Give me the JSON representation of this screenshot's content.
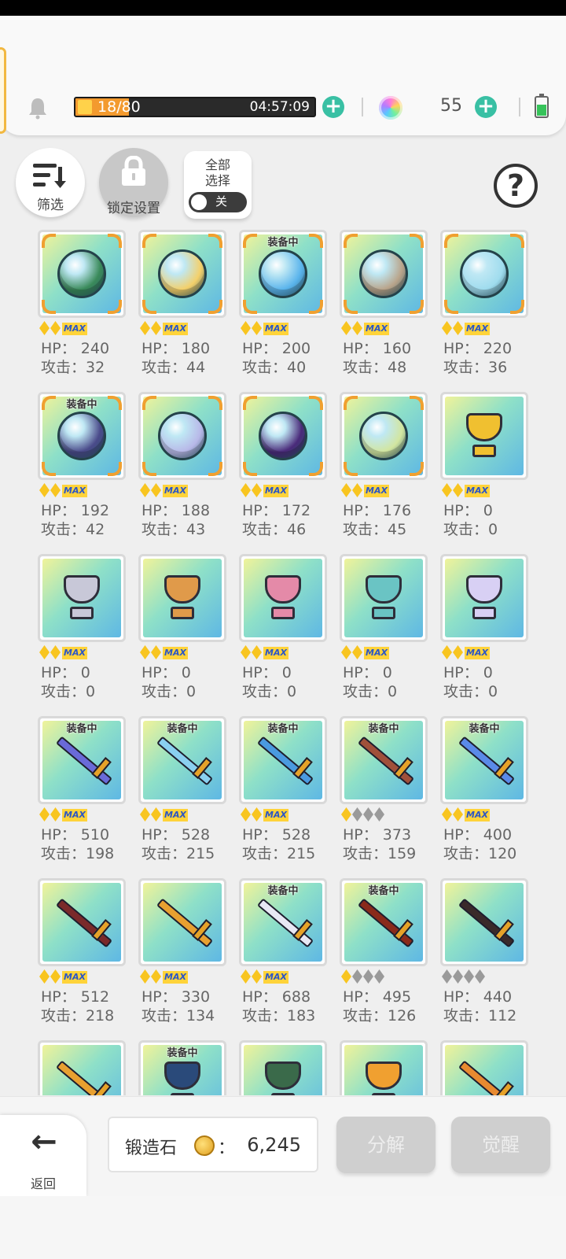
{
  "header": {
    "energy_current": "18",
    "energy_separator": "/",
    "energy_max": "80",
    "energy_progress": 0.225,
    "timer": "04:57:09",
    "gems": "55"
  },
  "toolbar": {
    "filter_label": "筛选",
    "lock_label": "锁定设置",
    "select_all_line1": "全部",
    "select_all_line2": "选择",
    "toggle_label": "关",
    "help_label": "?"
  },
  "items": [
    {
      "kind": "sphere",
      "scene": "#3a8a5a",
      "equipped": "",
      "stars": 2,
      "max": "MAX",
      "hp": "HP： 240",
      "atk": "攻击：32"
    },
    {
      "kind": "sphere",
      "scene": "#f4d06a",
      "equipped": "",
      "stars": 2,
      "max": "MAX",
      "hp": "HP： 180",
      "atk": "攻击：44"
    },
    {
      "kind": "sphere",
      "scene": "#5ab4ec",
      "equipped": "装备中",
      "stars": 2,
      "max": "MAX",
      "hp": "HP： 200",
      "atk": "攻击：40"
    },
    {
      "kind": "sphere",
      "scene": "#b9a48a",
      "equipped": "",
      "stars": 2,
      "max": "MAX",
      "hp": "HP： 160",
      "atk": "攻击：48"
    },
    {
      "kind": "sphere",
      "scene": "#9fdcee",
      "equipped": "",
      "stars": 2,
      "max": "MAX",
      "hp": "HP： 220",
      "atk": "攻击：36"
    },
    {
      "kind": "sphere",
      "scene": "#4a4a8a",
      "equipped": "装备中",
      "stars": 2,
      "max": "MAX",
      "hp": "HP： 192",
      "atk": "攻击：42"
    },
    {
      "kind": "sphere",
      "scene": "#b8b8e8",
      "equipped": "",
      "stars": 2,
      "max": "MAX",
      "hp": "HP： 188",
      "atk": "攻击：43"
    },
    {
      "kind": "sphere",
      "scene": "#4a2a7a",
      "equipped": "",
      "stars": 2,
      "max": "MAX",
      "hp": "HP： 172",
      "atk": "攻击：46"
    },
    {
      "kind": "sphere",
      "scene": "#d2e6a0",
      "equipped": "",
      "stars": 2,
      "max": "MAX",
      "hp": "HP： 176",
      "atk": "攻击：45"
    },
    {
      "kind": "trophy",
      "scene": "#f0c030",
      "equipped": "",
      "stars": 2,
      "max": "MAX",
      "hp": "HP： 0",
      "atk": "攻击：0"
    },
    {
      "kind": "trophy",
      "scene": "#c8c8d8",
      "equipped": "",
      "stars": 2,
      "max": "MAX",
      "hp": "HP： 0",
      "atk": "攻击：0"
    },
    {
      "kind": "trophy",
      "scene": "#e09a4a",
      "equipped": "",
      "stars": 2,
      "max": "MAX",
      "hp": "HP： 0",
      "atk": "攻击：0"
    },
    {
      "kind": "trophy",
      "scene": "#e48aa8",
      "equipped": "",
      "stars": 2,
      "max": "MAX",
      "hp": "HP： 0",
      "atk": "攻击：0"
    },
    {
      "kind": "trophy",
      "scene": "#6ac4c4",
      "equipped": "",
      "stars": 2,
      "max": "MAX",
      "hp": "HP： 0",
      "atk": "攻击：0"
    },
    {
      "kind": "trophy",
      "scene": "#d8d0f4",
      "equipped": "",
      "stars": 2,
      "max": "MAX",
      "hp": "HP： 0",
      "atk": "攻击：0"
    },
    {
      "kind": "weapon",
      "scene": "#6a6ad8",
      "equipped": "装备中",
      "stars": 2,
      "max": "MAX",
      "hp": "HP： 510",
      "atk": "攻击：198"
    },
    {
      "kind": "weapon",
      "scene": "#8ad0f0",
      "equipped": "装备中",
      "stars": 2,
      "max": "MAX",
      "hp": "HP： 528",
      "atk": "攻击：215"
    },
    {
      "kind": "weapon",
      "scene": "#4a9ae0",
      "equipped": "装备中",
      "stars": 2,
      "max": "MAX",
      "hp": "HP： 528",
      "atk": "攻击：215"
    },
    {
      "kind": "weapon",
      "scene": "#a0503a",
      "equipped": "装备中",
      "stars": 1,
      "max": "",
      "hp": "HP： 373",
      "atk": "攻击：159"
    },
    {
      "kind": "weapon",
      "scene": "#5a8ae8",
      "equipped": "装备中",
      "stars": 2,
      "max": "MAX",
      "hp": "HP： 400",
      "atk": "攻击：120"
    },
    {
      "kind": "weapon",
      "scene": "#7a2a2a",
      "equipped": "",
      "stars": 2,
      "max": "MAX",
      "hp": "HP： 512",
      "atk": "攻击：218"
    },
    {
      "kind": "weapon",
      "scene": "#e8a030",
      "equipped": "",
      "stars": 2,
      "max": "MAX",
      "hp": "HP： 330",
      "atk": "攻击：134"
    },
    {
      "kind": "weapon",
      "scene": "#e8e8f4",
      "equipped": "装备中",
      "stars": 2,
      "max": "MAX",
      "hp": "HP： 688",
      "atk": "攻击：183"
    },
    {
      "kind": "weapon",
      "scene": "#8a2a1a",
      "equipped": "装备中",
      "stars": 1,
      "max": "",
      "hp": "HP： 495",
      "atk": "攻击：126"
    },
    {
      "kind": "weapon",
      "scene": "#3a2a2a",
      "equipped": "",
      "stars": 0,
      "max": "",
      "hp": "HP： 440",
      "atk": "攻击：112"
    },
    {
      "kind": "weapon",
      "scene": "#e8a030",
      "equipped": "",
      "stars": 0,
      "max": "",
      "hp": "",
      "atk": ""
    },
    {
      "kind": "trophy",
      "scene": "#2a4a7a",
      "equipped": "装备中",
      "stars": 0,
      "max": "",
      "hp": "",
      "atk": ""
    },
    {
      "kind": "trophy",
      "scene": "#3a6a4a",
      "equipped": "",
      "stars": 0,
      "max": "",
      "hp": "",
      "atk": ""
    },
    {
      "kind": "trophy",
      "scene": "#f0a030",
      "equipped": "",
      "stars": 0,
      "max": "",
      "hp": "",
      "atk": ""
    },
    {
      "kind": "weapon",
      "scene": "#e88a30",
      "equipped": "",
      "stars": 0,
      "max": "",
      "hp": "",
      "atk": ""
    }
  ],
  "footer": {
    "back_arrow": "←",
    "back_label": "返回",
    "stone_label": "锻造石",
    "stone_colon": "：",
    "stone_value": "6,245",
    "decompose_label": "分解",
    "awaken_label": "觉醒"
  },
  "colors": {
    "accent": "#39c0a4",
    "energy": "#f39a2e",
    "star": "#f8c520",
    "star_empty": "#9a9a9a"
  }
}
